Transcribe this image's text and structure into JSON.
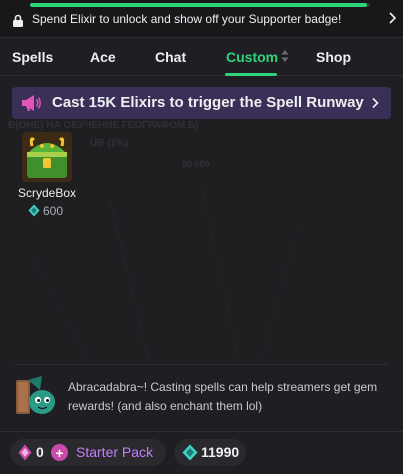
{
  "banner": {
    "progress": 0.99,
    "text": "Spend Elixir to unlock and show off your Supporter badge!"
  },
  "tabs": [
    {
      "label": "Spells",
      "active": false
    },
    {
      "label": "Ace",
      "active": false
    },
    {
      "label": "Chat",
      "active": false
    },
    {
      "label": "Custom",
      "active": true
    },
    {
      "label": "Shop",
      "active": false
    }
  ],
  "runway": {
    "text": "Cast 15K Elixirs to trigger the Spell Runway"
  },
  "background_text": {
    "line1": "Ð(ÖНЕ) НА ОБУЧЕНИЕ ГЕОГРАФОМ Б)",
    "line2": "UB (1%)",
    "line3": "50 000"
  },
  "items": [
    {
      "name": "ScrydeBox",
      "price": "600"
    }
  ],
  "hint": {
    "text": "Abracadabra~! Casting spells can help streamers get gem rewards! (and also enchant them lol)"
  },
  "footer": {
    "bits_count": "0",
    "starter_pack_label": "Starter Pack",
    "gem_count": "11990"
  },
  "colors": {
    "accent_green": "#2fd37a",
    "runway_bg": "#3a3057",
    "starter_purple": "#c77dff",
    "gem_teal": "#3fd6c8"
  }
}
